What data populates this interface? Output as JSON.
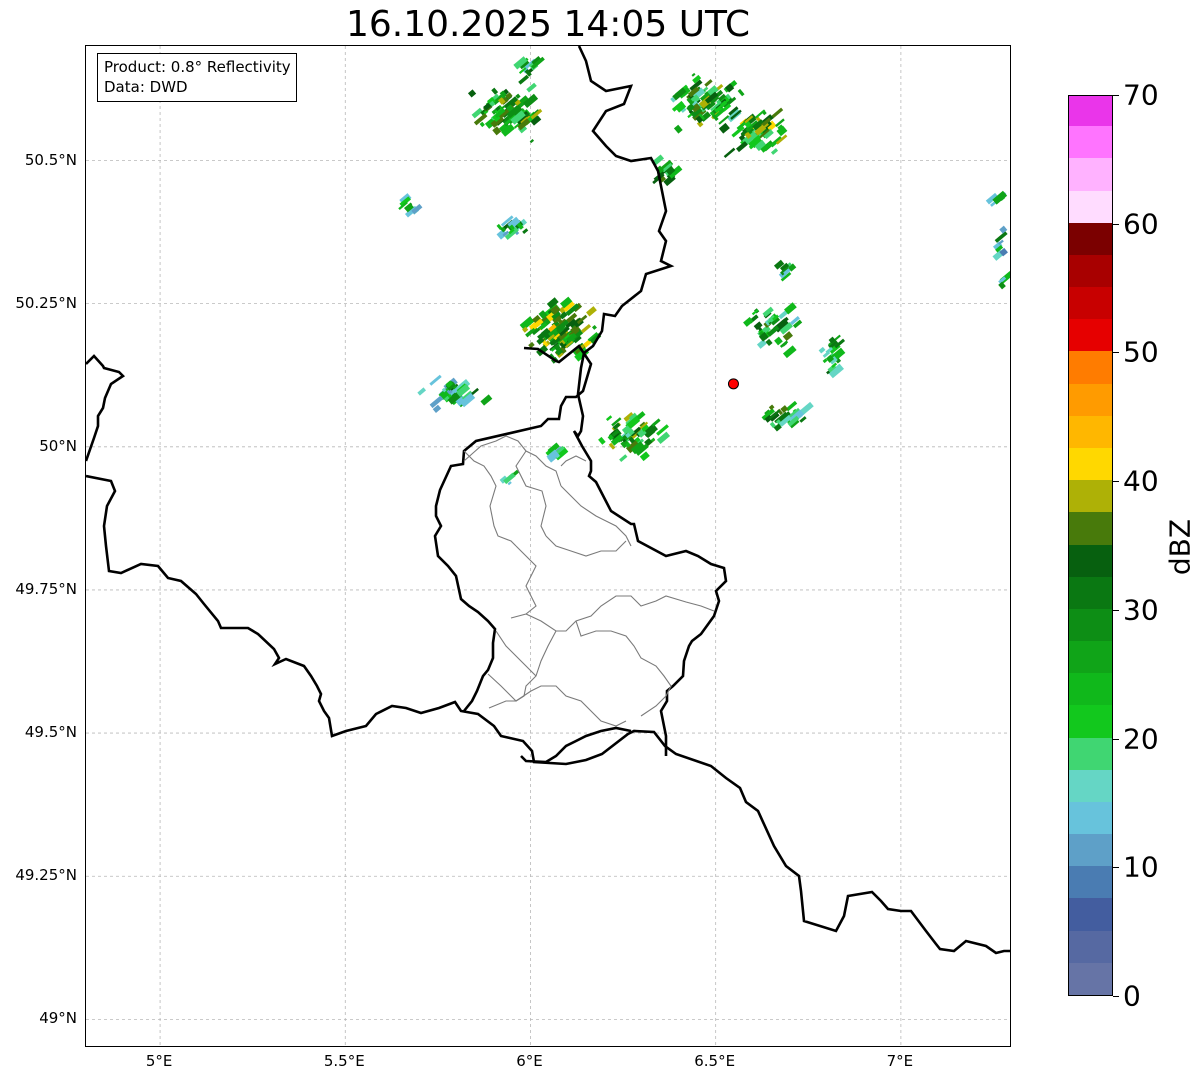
{
  "title": "16.10.2025 14:05 UTC",
  "info": {
    "product": "Product: 0.8° Reflectivity",
    "data_source": "Data: DWD"
  },
  "map": {
    "lon_range": [
      4.8,
      7.3
    ],
    "lat_range": [
      48.95,
      50.7
    ],
    "radar_site": {
      "lon": 6.548,
      "lat": 50.11
    },
    "lat_ticks": [
      {
        "value": 50.5,
        "label": "50.5°N"
      },
      {
        "value": 50.25,
        "label": "50.25°N"
      },
      {
        "value": 50.0,
        "label": "50°N"
      },
      {
        "value": 49.75,
        "label": "49.75°N"
      },
      {
        "value": 49.5,
        "label": "49.5°N"
      },
      {
        "value": 49.25,
        "label": "49.25°N"
      },
      {
        "value": 49.0,
        "label": "49°N"
      }
    ],
    "lon_ticks": [
      {
        "value": 5.0,
        "label": "5°E"
      },
      {
        "value": 5.5,
        "label": "5.5°E"
      },
      {
        "value": 6.0,
        "label": "6°E"
      },
      {
        "value": 6.5,
        "label": "6.5°E"
      },
      {
        "value": 7.0,
        "label": "7°E"
      }
    ]
  },
  "colorbar": {
    "label": "dBZ",
    "min": 0,
    "max": 70,
    "ticks": [
      {
        "value": 0,
        "label": "0"
      },
      {
        "value": 10,
        "label": "10"
      },
      {
        "value": 20,
        "label": "20"
      },
      {
        "value": 30,
        "label": "30"
      },
      {
        "value": 40,
        "label": "40"
      },
      {
        "value": 50,
        "label": "50"
      },
      {
        "value": 60,
        "label": "60"
      },
      {
        "value": 70,
        "label": "70"
      }
    ],
    "colors": [
      "#6674a6",
      "#5669a2",
      "#435d9f",
      "#4a7cb2",
      "#5ea0c8",
      "#67c3dc",
      "#65d6c5",
      "#40d672",
      "#12c81d",
      "#10b81b",
      "#10a418",
      "#0d8e15",
      "#0a7812",
      "#07600f",
      "#487a0b",
      "#aeb106",
      "#ffd800",
      "#ffb700",
      "#ff9b00",
      "#ff7c00",
      "#e60000",
      "#c80000",
      "#a80000",
      "#7b0000",
      "#ffdcff",
      "#ffb2ff",
      "#ff74ff",
      "#ea35ea"
    ]
  },
  "echo_clusters": [
    {
      "lon": 5.92,
      "lat": 50.58,
      "spread": [
        0.12,
        0.07
      ],
      "n": 70,
      "level": 12
    },
    {
      "lon": 5.98,
      "lat": 50.66,
      "spread": [
        0.04,
        0.02
      ],
      "n": 12,
      "level": 10
    },
    {
      "lon": 6.46,
      "lat": 50.6,
      "spread": [
        0.13,
        0.06
      ],
      "n": 80,
      "level": 12
    },
    {
      "lon": 6.6,
      "lat": 50.55,
      "spread": [
        0.1,
        0.05
      ],
      "n": 60,
      "level": 13
    },
    {
      "lon": 6.35,
      "lat": 50.48,
      "spread": [
        0.05,
        0.03
      ],
      "n": 15,
      "level": 11
    },
    {
      "lon": 5.66,
      "lat": 50.42,
      "spread": [
        0.03,
        0.02
      ],
      "n": 8,
      "level": 9
    },
    {
      "lon": 5.94,
      "lat": 50.38,
      "spread": [
        0.07,
        0.03
      ],
      "n": 16,
      "level": 10
    },
    {
      "lon": 6.07,
      "lat": 50.2,
      "spread": [
        0.12,
        0.07
      ],
      "n": 110,
      "level": 14
    },
    {
      "lon": 5.78,
      "lat": 50.09,
      "spread": [
        0.1,
        0.04
      ],
      "n": 35,
      "level": 10
    },
    {
      "lon": 6.26,
      "lat": 50.02,
      "spread": [
        0.09,
        0.05
      ],
      "n": 55,
      "level": 12
    },
    {
      "lon": 6.68,
      "lat": 50.05,
      "spread": [
        0.09,
        0.03
      ],
      "n": 28,
      "level": 11
    },
    {
      "lon": 6.64,
      "lat": 50.21,
      "spread": [
        0.1,
        0.06
      ],
      "n": 40,
      "level": 11
    },
    {
      "lon": 6.8,
      "lat": 50.16,
      "spread": [
        0.03,
        0.05
      ],
      "n": 18,
      "level": 11
    },
    {
      "lon": 6.68,
      "lat": 50.31,
      "spread": [
        0.03,
        0.03
      ],
      "n": 8,
      "level": 10
    },
    {
      "lon": 7.26,
      "lat": 50.33,
      "spread": [
        0.02,
        0.06
      ],
      "n": 10,
      "level": 9
    },
    {
      "lon": 7.25,
      "lat": 50.43,
      "spread": [
        0.03,
        0.02
      ],
      "n": 6,
      "level": 9
    },
    {
      "lon": 5.93,
      "lat": 49.94,
      "spread": [
        0.02,
        0.02
      ],
      "n": 5,
      "level": 9
    },
    {
      "lon": 6.05,
      "lat": 49.99,
      "spread": [
        0.03,
        0.02
      ],
      "n": 8,
      "level": 9
    }
  ]
}
